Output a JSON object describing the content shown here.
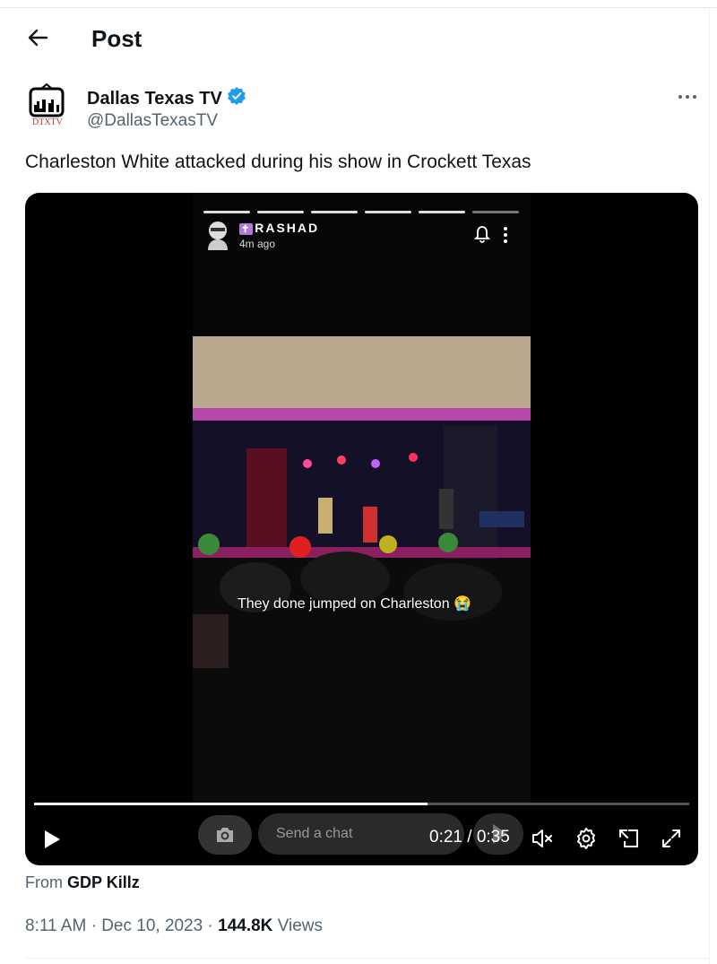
{
  "header": {
    "title": "Post"
  },
  "author": {
    "name": "Dallas Texas TV",
    "handle": "@DallasTexasTV",
    "avatar_text": "DTXTV",
    "verified": true,
    "verified_color": "#1d9bf0"
  },
  "post": {
    "text": "Charleston White attacked during his show in Crockett Texas"
  },
  "video": {
    "story_user": "RASHAD",
    "story_time": "4m ago",
    "caption": "They done jumped on Charleston 😭",
    "chat_placeholder": "Send a chat",
    "time_display": "0:21 / 0:35",
    "played_fraction": 0.6
  },
  "source": {
    "prefix": "From",
    "name": "GDP Killz"
  },
  "meta": {
    "time": "8:11 AM",
    "date": "Dec 10, 2023",
    "views_count": "144.8K",
    "views_label": "Views",
    "sep": "·"
  }
}
